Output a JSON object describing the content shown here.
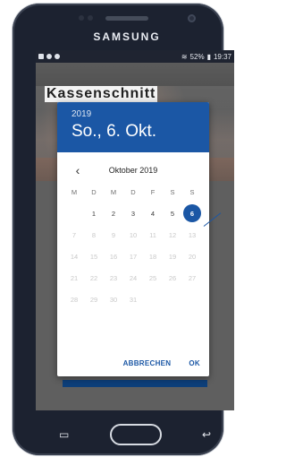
{
  "device": {
    "brand": "SAMSUNG",
    "status_bar": {
      "battery_percent": "52%",
      "time": "19:37"
    }
  },
  "app": {
    "background_title": "Kassenschnitt"
  },
  "date_picker": {
    "year": "2019",
    "selected_date_label": "So., 6. Okt.",
    "month_label": "Oktober 2019",
    "weekday_labels": [
      "M",
      "D",
      "M",
      "D",
      "F",
      "S",
      "S"
    ],
    "days": [
      "",
      "1",
      "2",
      "3",
      "4",
      "5",
      "6",
      "7",
      "8",
      "9",
      "10",
      "11",
      "12",
      "13",
      "14",
      "15",
      "16",
      "17",
      "18",
      "19",
      "20",
      "21",
      "22",
      "23",
      "24",
      "25",
      "26",
      "27",
      "28",
      "29",
      "30",
      "31",
      "",
      "",
      ""
    ],
    "selected_day": "6",
    "actions": {
      "cancel": "ABBRECHEN",
      "ok": "OK"
    },
    "colors": {
      "accent": "#1B57A5",
      "disabled": "#C8C8C8"
    }
  },
  "navigation": {
    "recent_icon": "recent-apps-icon",
    "home_icon": "home-button",
    "back_icon": "back-icon"
  }
}
